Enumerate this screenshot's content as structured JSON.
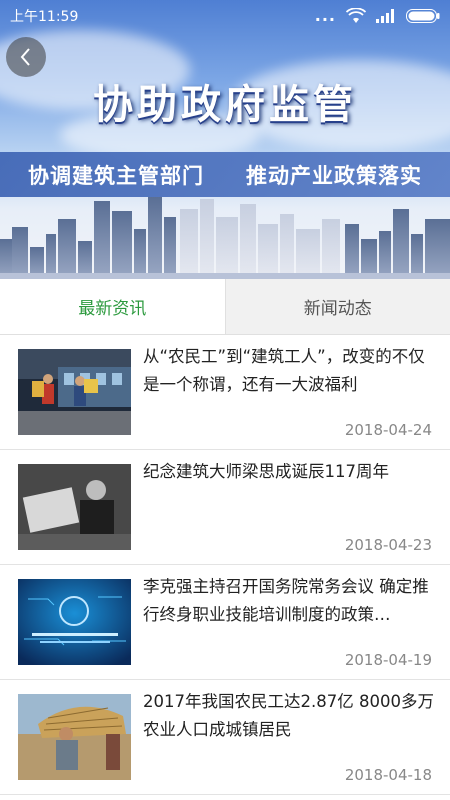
{
  "status_bar": {
    "time": "上午11:59",
    "dots": "..."
  },
  "hero": {
    "title": "协助政府监管",
    "slogan_left": "协调建筑主管部门",
    "slogan_right": "推动产业政策落实"
  },
  "tabs": [
    {
      "label": "最新资讯",
      "active": true
    },
    {
      "label": "新闻动态",
      "active": false
    }
  ],
  "news": [
    {
      "title": "从“农民工”到“建筑工人”，改变的不仅是一个称谓，还有一大波福利",
      "date": "2018-04-24",
      "thumb": "workers-on-platform"
    },
    {
      "title": "纪念建筑大师梁思成诞辰117周年",
      "date": "2018-04-23",
      "thumb": "architect-portrait"
    },
    {
      "title": "李克强主持召开国务院常务会议 确定推行终身职业技能培训制度的政策…",
      "date": "2018-04-19",
      "thumb": "blue-tech-graphic"
    },
    {
      "title": "2017年我国农民工达2.87亿 8000多万农业人口成城镇居民",
      "date": "2018-04-18",
      "thumb": "farmer-carrying-straw"
    }
  ],
  "colors": {
    "accent_green": "#2c9a3e",
    "hero_blue": "#4f7fd3"
  }
}
